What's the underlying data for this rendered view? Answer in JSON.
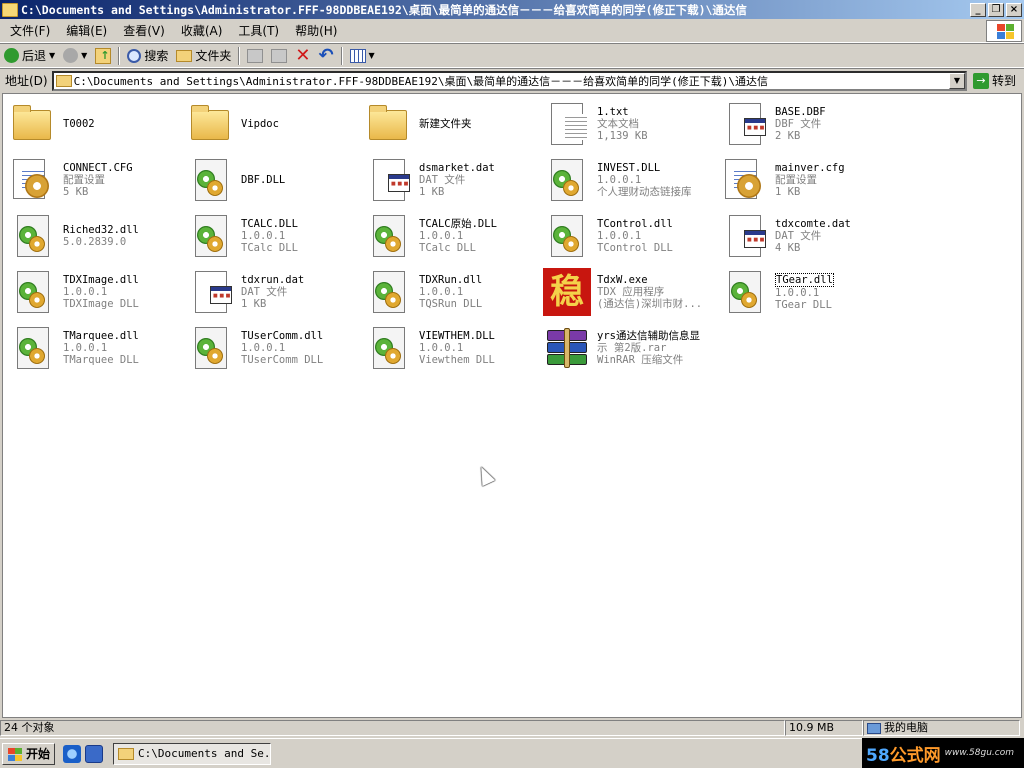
{
  "window": {
    "title": "C:\\Documents and Settings\\Administrator.FFF-98DDBEAE192\\桌面\\最简单的通达信－－－给喜欢简单的同学(修正下载)\\通达信",
    "buttons": [
      "_",
      "❐",
      "×"
    ]
  },
  "menu": [
    "文件(F)",
    "编辑(E)",
    "查看(V)",
    "收藏(A)",
    "工具(T)",
    "帮助(H)"
  ],
  "toolbar": {
    "back": "后退",
    "search": "搜索",
    "folders": "文件夹"
  },
  "address": {
    "label": "地址(D)",
    "value": "C:\\Documents and Settings\\Administrator.FFF-98DDBEAE192\\桌面\\最简单的通达信－－－给喜欢简单的同学(修正下载)\\通达信",
    "go": "转到"
  },
  "files": [
    {
      "name": "T0002",
      "line2": "",
      "line3": "",
      "icon": "folder"
    },
    {
      "name": "Vipdoc",
      "line2": "",
      "line3": "",
      "icon": "folder"
    },
    {
      "name": "新建文件夹",
      "line2": "",
      "line3": "",
      "icon": "folder"
    },
    {
      "name": "1.txt",
      "line2": "文本文档",
      "line3": "1,139 KB",
      "icon": "text"
    },
    {
      "name": "BASE.DBF",
      "line2": "DBF 文件",
      "line3": "2 KB",
      "icon": "data"
    },
    {
      "name": "CONNECT.CFG",
      "line2": "配置设置",
      "line3": "5 KB",
      "icon": "config"
    },
    {
      "name": "DBF.DLL",
      "line2": "",
      "line3": "",
      "icon": "dll"
    },
    {
      "name": "dsmarket.dat",
      "line2": "DAT 文件",
      "line3": "1 KB",
      "icon": "data"
    },
    {
      "name": "INVEST.DLL",
      "line2": "1.0.0.1",
      "line3": "个人理财动态链接库",
      "icon": "dll"
    },
    {
      "name": "mainver.cfg",
      "line2": "配置设置",
      "line3": "1 KB",
      "icon": "config"
    },
    {
      "name": "Riched32.dll",
      "line2": "5.0.2839.0",
      "line3": "",
      "icon": "dll"
    },
    {
      "name": "TCALC.DLL",
      "line2": "1.0.0.1",
      "line3": "TCalc DLL",
      "icon": "dll"
    },
    {
      "name": "TCALC原始.DLL",
      "line2": "1.0.0.1",
      "line3": "TCalc DLL",
      "icon": "dll"
    },
    {
      "name": "TControl.dll",
      "line2": "1.0.0.1",
      "line3": "TControl DLL",
      "icon": "dll"
    },
    {
      "name": "tdxcomte.dat",
      "line2": "DAT 文件",
      "line3": "4 KB",
      "icon": "data"
    },
    {
      "name": "TDXImage.dll",
      "line2": "1.0.0.1",
      "line3": "TDXImage DLL",
      "icon": "dll"
    },
    {
      "name": "tdxrun.dat",
      "line2": "DAT 文件",
      "line3": "1 KB",
      "icon": "data"
    },
    {
      "name": "TDXRun.dll",
      "line2": "1.0.0.1",
      "line3": "TQSRun DLL",
      "icon": "dll"
    },
    {
      "name": "TdxW.exe",
      "line2": "TDX 应用程序",
      "line3": "(通达信)深圳市财...",
      "icon": "exe",
      "glyph": "稳"
    },
    {
      "name": "TGear.dll",
      "line2": "1.0.0.1",
      "line3": "TGear DLL",
      "icon": "dll",
      "selected": true
    },
    {
      "name": "TMarquee.dll",
      "line2": "1.0.0.1",
      "line3": "TMarquee DLL",
      "icon": "dll"
    },
    {
      "name": "TUserComm.dll",
      "line2": "1.0.0.1",
      "line3": "TUserComm DLL",
      "icon": "dll"
    },
    {
      "name": "VIEWTHEM.DLL",
      "line2": "1.0.0.1",
      "line3": "Viewthem DLL",
      "icon": "dll"
    },
    {
      "name": "yrs通达信辅助信息显",
      "line2": "示 第2版.rar",
      "line3": "WinRAR 压缩文件",
      "icon": "rar"
    }
  ],
  "status": {
    "count": "24 个对象",
    "size": "10.9 MB",
    "location": "我的电脑"
  },
  "taskbar": {
    "start": "开始",
    "task": "C:\\Documents and Se..."
  },
  "watermark": {
    "num": "58",
    "text": "公式网",
    "url": "www.58gu.com"
  }
}
